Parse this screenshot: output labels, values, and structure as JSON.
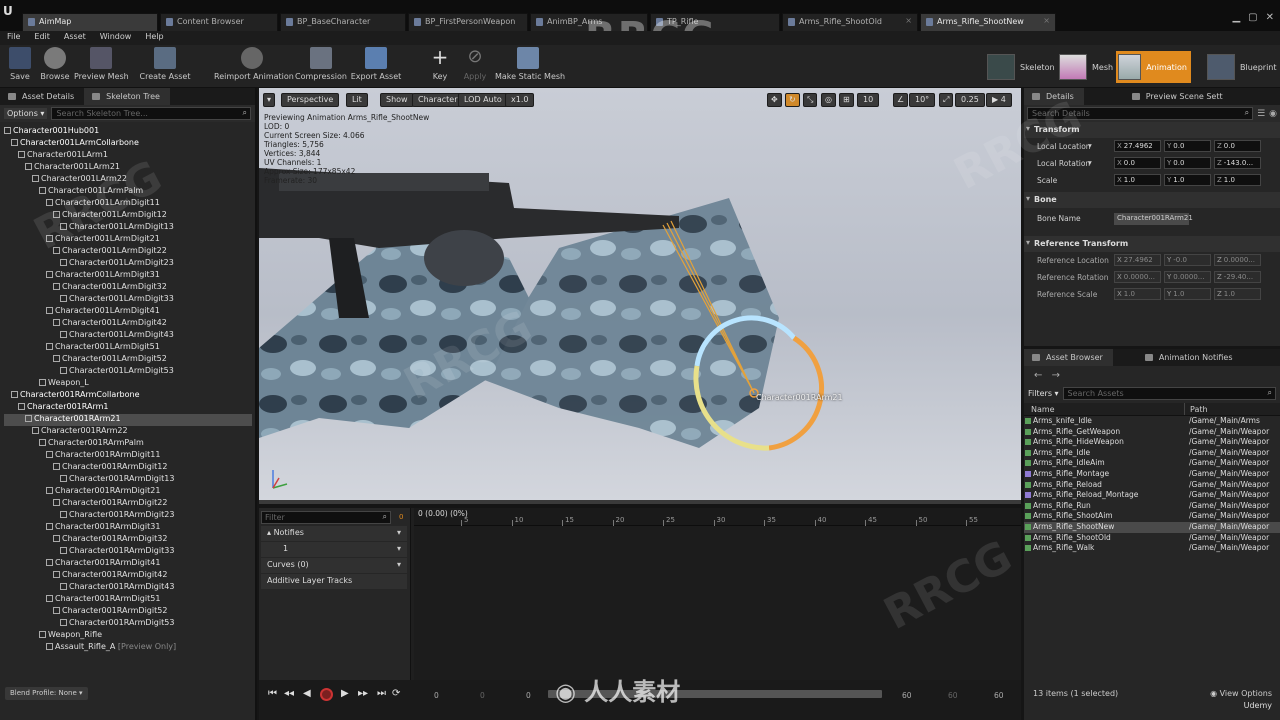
{
  "window": {
    "tabs": [
      {
        "label": "AimMap",
        "active": true
      },
      {
        "label": "Content Browser"
      },
      {
        "label": "BP_BaseCharacter"
      },
      {
        "label": "BP_FirstPersonWeapon"
      },
      {
        "label": "AnimBP_Arms"
      },
      {
        "label": "TP_Rifle"
      },
      {
        "label": "Arms_Rifle_ShootOld"
      },
      {
        "label": "Arms_Rifle_ShootNew"
      }
    ],
    "watermark": "RRCG"
  },
  "menu": [
    "File",
    "Edit",
    "Asset",
    "Window",
    "Help"
  ],
  "toolbar": {
    "buttons": [
      "Save",
      "Browse",
      "Preview Mesh",
      "Create Asset",
      "Reimport Animation",
      "Compression",
      "Export Asset",
      "Key",
      "Apply",
      "Make Static Mesh"
    ],
    "modes": [
      "Skeleton",
      "Mesh",
      "Animation",
      "Blueprint"
    ]
  },
  "left_panel": {
    "tabs": [
      "Asset Details",
      "Skeleton Tree"
    ],
    "options_label": "Options",
    "search_placeholder": "Search Skeleton Tree...",
    "tree": [
      "Character001Hub001",
      "Character001LArmCollarbone",
      "Character001LArm1",
      "Character001LArm21",
      "Character001LArm22",
      "Character001LArmPalm",
      "Character001LArmDigit11",
      "Character001LArmDigit12",
      "Character001LArmDigit13",
      "Character001LArmDigit21",
      "Character001LArmDigit22",
      "Character001LArmDigit23",
      "Character001LArmDigit31",
      "Character001LArmDigit32",
      "Character001LArmDigit33",
      "Character001LArmDigit41",
      "Character001LArmDigit42",
      "Character001LArmDigit43",
      "Character001LArmDigit51",
      "Character001LArmDigit52",
      "Character001LArmDigit53",
      "Weapon_L",
      "Character001RArmCollarbone",
      "Character001RArm1",
      "Character001RArm21",
      "Character001RArm22",
      "Character001RArmPalm",
      "Character001RArmDigit11",
      "Character001RArmDigit12",
      "Character001RArmDigit13",
      "Character001RArmDigit21",
      "Character001RArmDigit22",
      "Character001RArmDigit23",
      "Character001RArmDigit31",
      "Character001RArmDigit32",
      "Character001RArmDigit33",
      "Character001RArmDigit41",
      "Character001RArmDigit42",
      "Character001RArmDigit43",
      "Character001RArmDigit51",
      "Character001RArmDigit52",
      "Character001RArmDigit53",
      "Weapon_Rifle",
      "Assault_Rifle_A"
    ],
    "preview_only": "[Preview Only]",
    "blend_profile": "Blend Profile: None"
  },
  "viewport": {
    "perspective": "Perspective",
    "lit": "Lit",
    "show": "Show",
    "character": "Character",
    "lod": "LOD Auto",
    "speed": "x1.0",
    "grid": "10",
    "angle": "10°",
    "scale": "0.25",
    "cam_speed": "4",
    "stats": [
      "Previewing Animation Arms_Rifle_ShootNew",
      "LOD: 0",
      "Current Screen Size: 4.066",
      "Triangles: 5,756",
      "Vertices: 3,844",
      "UV Channels: 1",
      "Approx Size: 177x85x42",
      "Framerate: 30"
    ],
    "bone_label": "Character001RArm21"
  },
  "timeline": {
    "filter_placeholder": "Filter",
    "frame_marker": "0",
    "cursor_label": "0 (0.00) (0%)",
    "tracks": [
      "Notifies",
      "1",
      "Curves",
      "(0)",
      "Additive Layer Tracks"
    ],
    "ticks": [
      "5",
      "10",
      "15",
      "20",
      "25",
      "30",
      "35",
      "40",
      "45",
      "50",
      "55"
    ],
    "playback_numbers": [
      "0",
      "0",
      "0",
      "60",
      "60",
      "60"
    ]
  },
  "details": {
    "tabs": [
      "Details",
      "Preview Scene Sett"
    ],
    "search_placeholder": "Search Details",
    "transform_header": "Transform",
    "local_location": {
      "label": "Local Location",
      "x": "27.4962",
      "y": "0.0",
      "z": "0.0"
    },
    "local_rotation": {
      "label": "Local Rotation",
      "x": "0.0",
      "y": "0.0",
      "z": "-143.0..."
    },
    "scale": {
      "label": "Scale",
      "x": "1.0",
      "y": "1.0",
      "z": "1.0"
    },
    "bone_header": "Bone",
    "bone_name_label": "Bone Name",
    "bone_name_value": "Character001RArm21",
    "ref_header": "Reference Transform",
    "ref_location": {
      "label": "Reference Location",
      "x": "27.4962",
      "y": "-0.0",
      "z": "0.0000..."
    },
    "ref_rotation": {
      "label": "Reference Rotation",
      "x": "0.0000...",
      "y": "0.0000...",
      "z": "-29.40..."
    },
    "ref_scale": {
      "label": "Reference Scale",
      "x": "1.0",
      "y": "1.0",
      "z": "1.0"
    }
  },
  "asset_browser": {
    "tabs": [
      "Asset Browser",
      "Animation Notifies"
    ],
    "filters": "Filters",
    "search_placeholder": "Search Assets",
    "col_name": "Name",
    "col_path": "Path",
    "rows": [
      {
        "name": "Arms_knife_Idle",
        "path": "/Game/_Main/Arms"
      },
      {
        "name": "Arms_Rifle_GetWeapon",
        "path": "/Game/_Main/Weapor"
      },
      {
        "name": "Arms_Rifle_HideWeapon",
        "path": "/Game/_Main/Weapor"
      },
      {
        "name": "Arms_Rifle_Idle",
        "path": "/Game/_Main/Weapor"
      },
      {
        "name": "Arms_Rifle_IdleAim",
        "path": "/Game/_Main/Weapor"
      },
      {
        "name": "Arms_Rifle_Montage",
        "path": "/Game/_Main/Weapor"
      },
      {
        "name": "Arms_Rifle_Reload",
        "path": "/Game/_Main/Weapor"
      },
      {
        "name": "Arms_Rifle_Reload_Montage",
        "path": "/Game/_Main/Weapor"
      },
      {
        "name": "Arms_Rifle_Run",
        "path": "/Game/_Main/Weapor"
      },
      {
        "name": "Arms_Rifle_ShootAim",
        "path": "/Game/_Main/Weapor"
      },
      {
        "name": "Arms_Rifle_ShootNew",
        "path": "/Game/_Main/Weapor"
      },
      {
        "name": "Arms_Rifle_ShootOld",
        "path": "/Game/_Main/Weapor"
      },
      {
        "name": "Arms_Rifle_Walk",
        "path": "/Game/_Main/Weapor"
      }
    ],
    "count": "13 items (1 selected)",
    "view_options": "View Options",
    "brand": "Udemy"
  },
  "colors": {
    "accent": "#e08a1e",
    "panel": "#262626",
    "viewport_bg": "#c4c8d2"
  }
}
